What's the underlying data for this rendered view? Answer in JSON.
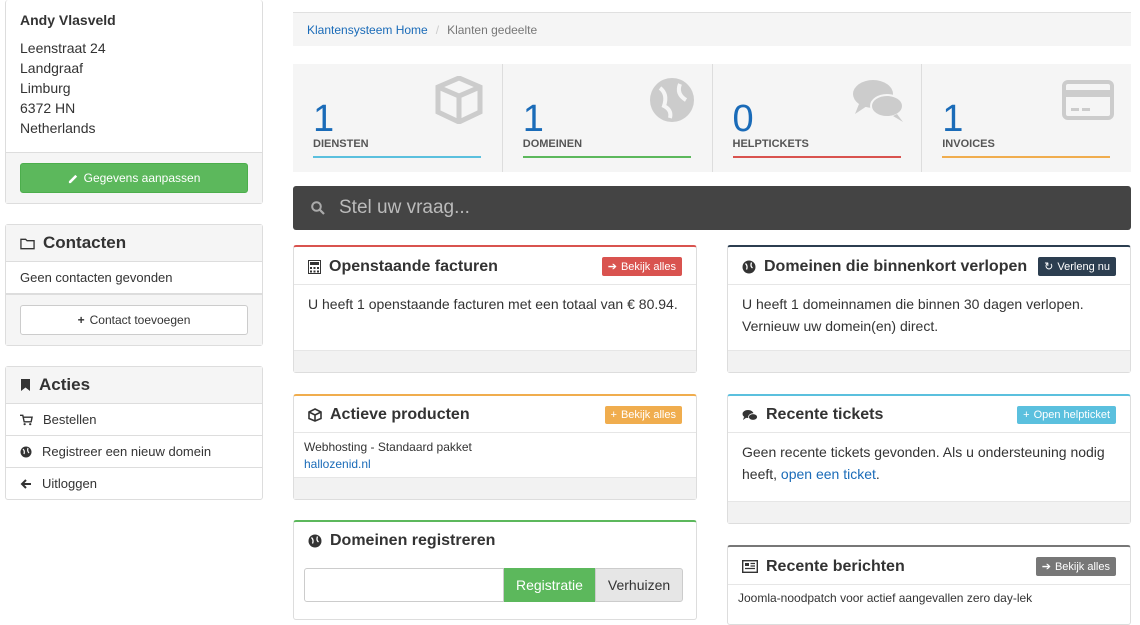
{
  "client": {
    "name": "Andy Vlasveld",
    "address_lines": [
      "Leenstraat 24",
      "Landgraaf",
      "Limburg",
      "6372 HN",
      "Netherlands"
    ],
    "edit_button": "Gegevens aanpassen"
  },
  "contacts": {
    "title": "Contacten",
    "empty_text": "Geen contacten gevonden",
    "add_button": "Contact toevoegen"
  },
  "actions": {
    "title": "Acties",
    "items": [
      {
        "label": "Bestellen",
        "icon": "cart-icon"
      },
      {
        "label": "Registreer een nieuw domein",
        "icon": "globe-icon"
      },
      {
        "label": "Uitloggen",
        "icon": "arrow-left-icon"
      }
    ]
  },
  "breadcrumb": {
    "home": "Klantensysteem Home",
    "current": "Klanten gedeelte"
  },
  "stats": [
    {
      "value": "1",
      "label": "DIENSTEN",
      "color": "#5bc0de",
      "icon": "cube-icon"
    },
    {
      "value": "1",
      "label": "DOMEINEN",
      "color": "#5cb85c",
      "icon": "globe-icon"
    },
    {
      "value": "0",
      "label": "HELPTICKETS",
      "color": "#d9534f",
      "icon": "comments-icon"
    },
    {
      "value": "1",
      "label": "INVOICES",
      "color": "#f0ad4e",
      "icon": "credit-card-icon"
    }
  ],
  "search": {
    "placeholder": "Stel uw vraag..."
  },
  "invoices": {
    "title": "Openstaande facturen",
    "button": "Bekijk alles",
    "text": "U heeft 1 openstaande facturen met een totaal van € 80.94.",
    "color": "#d9534f"
  },
  "expiring": {
    "title": "Domeinen die binnenkort verlopen",
    "button": "Verleng nu",
    "text": "U heeft 1 domeinnamen die binnen 30 dagen verlopen. Vernieuw uw domein(en) direct.",
    "color": "#2c3e50"
  },
  "products": {
    "title": "Actieve producten",
    "button": "Bekijk alles",
    "product_name": "Webhosting - Standaard pakket",
    "product_domain": "hallozenid.nl",
    "color": "#f0ad4e"
  },
  "tickets": {
    "title": "Recente tickets",
    "button": "Open helpticket",
    "text_before": "Geen recente tickets gevonden. Als u ondersteuning nodig heeft, ",
    "link": "open een ticket",
    "text_after": ".",
    "color": "#5bc0de"
  },
  "register": {
    "title": "Domeinen registreren",
    "register_button": "Registratie",
    "transfer_button": "Verhuizen",
    "color": "#5cb85c"
  },
  "news": {
    "title": "Recente berichten",
    "button": "Bekijk alles",
    "first_item": "Joomla-noodpatch voor actief aangevallen zero day-lek",
    "color": "#777777"
  }
}
